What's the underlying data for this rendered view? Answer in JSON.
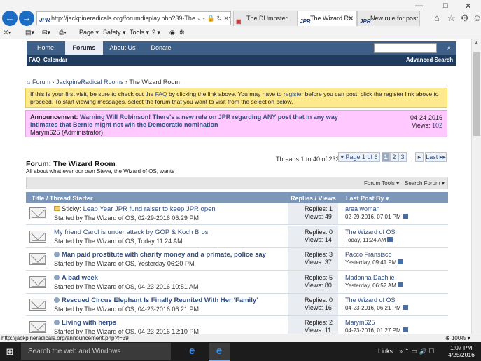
{
  "browser": {
    "address": "http://jackpineradicals.org/forumdisplay.php?39-The-Wizard-Roo",
    "tabs": [
      {
        "label": "The DUmpster"
      },
      {
        "label": "The Wizard Ro..."
      },
      {
        "label": "New rule for post..."
      }
    ],
    "menu": {
      "page": "Page ▾",
      "safety": "Safety ▾",
      "tools": "Tools ▾",
      "help": "? ▾"
    },
    "status_url": "http://jackpineradicals.org/announcement.php?f=39",
    "zoom": "100%"
  },
  "forum_nav": {
    "items": [
      "Home",
      "Forums",
      "About Us",
      "Donate"
    ],
    "sub": [
      "FAQ",
      "Calendar"
    ],
    "advanced_search": "Advanced Search"
  },
  "breadcrumb": {
    "forum": "Forum",
    "parent": "JackpineRadical Rooms",
    "current": "The Wizard Room"
  },
  "notice": {
    "text1": "If this is your first visit, be sure to check out the ",
    "faq": "FAQ",
    "text2": " by clicking the link above. You may have to ",
    "register": "register",
    "text3": " before you can post: click the register link above to proceed. To start viewing messages, select the forum that you want to visit from the selection below."
  },
  "announcement": {
    "label": "Announcement:",
    "title": "Warning Will Robinson! There's a new rule on JPR regarding ANY post that in any way intimates that Bernie might not win the Democratic nomination",
    "author": "Marym625 (Administrator)",
    "date": "04-24-2016",
    "views_label": "Views:",
    "views": "102"
  },
  "forum": {
    "title": "Forum: The Wizard Room",
    "description": "All about what ever our own Steve, the Wizard of OS, wants",
    "threads_info": "Threads 1 to 40 of 232"
  },
  "pagination": {
    "page_of": "Page 1 of 6",
    "pages": [
      "1",
      "2",
      "3"
    ],
    "ellipsis": "...",
    "next": "▸",
    "last": "Last ▸▸"
  },
  "tools": {
    "forum_tools": "Forum Tools ▾",
    "search_forum": "Search Forum ▾"
  },
  "table_header": {
    "title": "Title / Thread Starter",
    "replies": "Replies / Views",
    "last_post": "Last Post By ▾"
  },
  "threads": [
    {
      "prefix": "Sticky: ",
      "title": "Leap Year JPR fund raiser to keep JPR open",
      "starter": "Started by The Wizard of OS, 02-29-2016 06:29 PM",
      "replies": "Replies: 1",
      "views": "Views: 49",
      "last_by": "area woman",
      "last_date": "02-29-2016, 07:01 PM"
    },
    {
      "prefix": "",
      "title": "My friend Carol is under attack by GOP & Koch Bros",
      "starter": "Started by The Wizard of OS, Today 11:24 AM",
      "replies": "Replies: 0",
      "views": "Views: 14",
      "last_by": "The Wizard of OS",
      "last_date": "Today, 11:24 AM"
    },
    {
      "prefix": "",
      "title": "Man paid prostitute with charity money and a primate, police say",
      "starter": "Started by The Wizard of OS, Yesterday 06:20 PM",
      "replies": "Replies: 3",
      "views": "Views: 37",
      "last_by": "Pacco Fransisco",
      "last_date": "Yesterday, 09:41 PM"
    },
    {
      "prefix": "",
      "title": "A bad week",
      "starter": "Started by The Wizard of OS, 04-23-2016 10:51 AM",
      "replies": "Replies: 5",
      "views": "Views: 80",
      "last_by": "Madonna Daehlie",
      "last_date": "Yesterday, 06:52 AM"
    },
    {
      "prefix": "",
      "title": "Rescued Circus Elephant Is Finally Reunited With Her ‘Family’",
      "starter": "Started by The Wizard of OS, 04-23-2016 06:21 PM",
      "replies": "Replies: 0",
      "views": "Views: 16",
      "last_by": "The Wizard of OS",
      "last_date": "04-23-2016, 06:21 PM"
    },
    {
      "prefix": "",
      "title": "Living with herps",
      "starter": "Started by The Wizard of OS, 04-23-2016 12:10 PM",
      "replies": "Replies: 2",
      "views": "Views: 11",
      "last_by": "Marym625",
      "last_date": "04-23-2016, 01:27 PM"
    }
  ],
  "taskbar": {
    "search": "Search the web and Windows",
    "links": "Links",
    "time": "1:07 PM",
    "date": "4/25/2016"
  }
}
